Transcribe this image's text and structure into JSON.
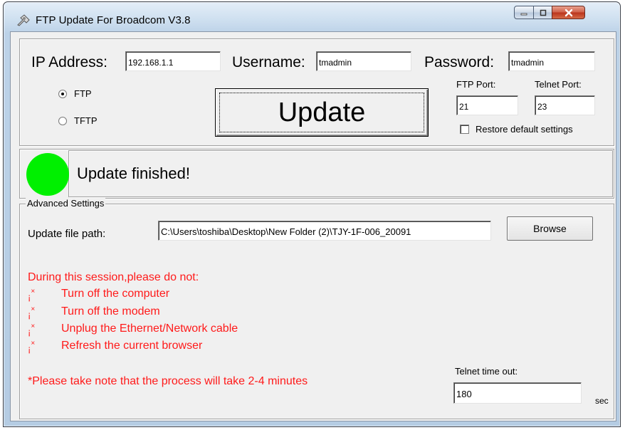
{
  "window": {
    "title": "FTP Update For Broadcom V3.8",
    "icons": {
      "app": "broadcom-app-icon",
      "minimize": "minimize-icon",
      "maximize": "maximize-icon",
      "close": "close-icon"
    }
  },
  "connection": {
    "ip_label": "IP Address:",
    "ip_value": "192.168.1.1",
    "username_label": "Username:",
    "username_value": "tmadmin",
    "password_label": "Password:",
    "password_value": "tmadmin",
    "ftp_port_label": "FTP Port:",
    "ftp_port_value": "21",
    "telnet_port_label": "Telnet Port:",
    "telnet_port_value": "23",
    "restore_label": "Restore default settings",
    "restore_checked": false,
    "protocol_options": [
      "FTP",
      "TFTP"
    ],
    "protocol_selected": "FTP",
    "update_label": "Update"
  },
  "status": {
    "text": "Update finished!",
    "color": "#00f000"
  },
  "advanced": {
    "legend": "Advanced Settings",
    "file_path_label": "Update file path:",
    "file_path_value": "C:\\Users\\toshiba\\Desktop\\New Folder (2)\\TJY-1F-006_20091",
    "browse_label": "Browse",
    "warning_heading": "During this session,please do not:",
    "bullet_glyph": "¡",
    "bullet_sup": "×",
    "warnings": [
      "Turn off the computer",
      "Turn off the modem",
      "Unplug the Ethernet/Network cable",
      "Refresh the current browser"
    ],
    "note": "*Please take note that the process will take 2-4 minutes",
    "telnet_timeout_label": "Telnet time out:",
    "telnet_timeout_value": "180",
    "timeout_unit": "sec",
    "warning_color": "#ff1a1a"
  }
}
